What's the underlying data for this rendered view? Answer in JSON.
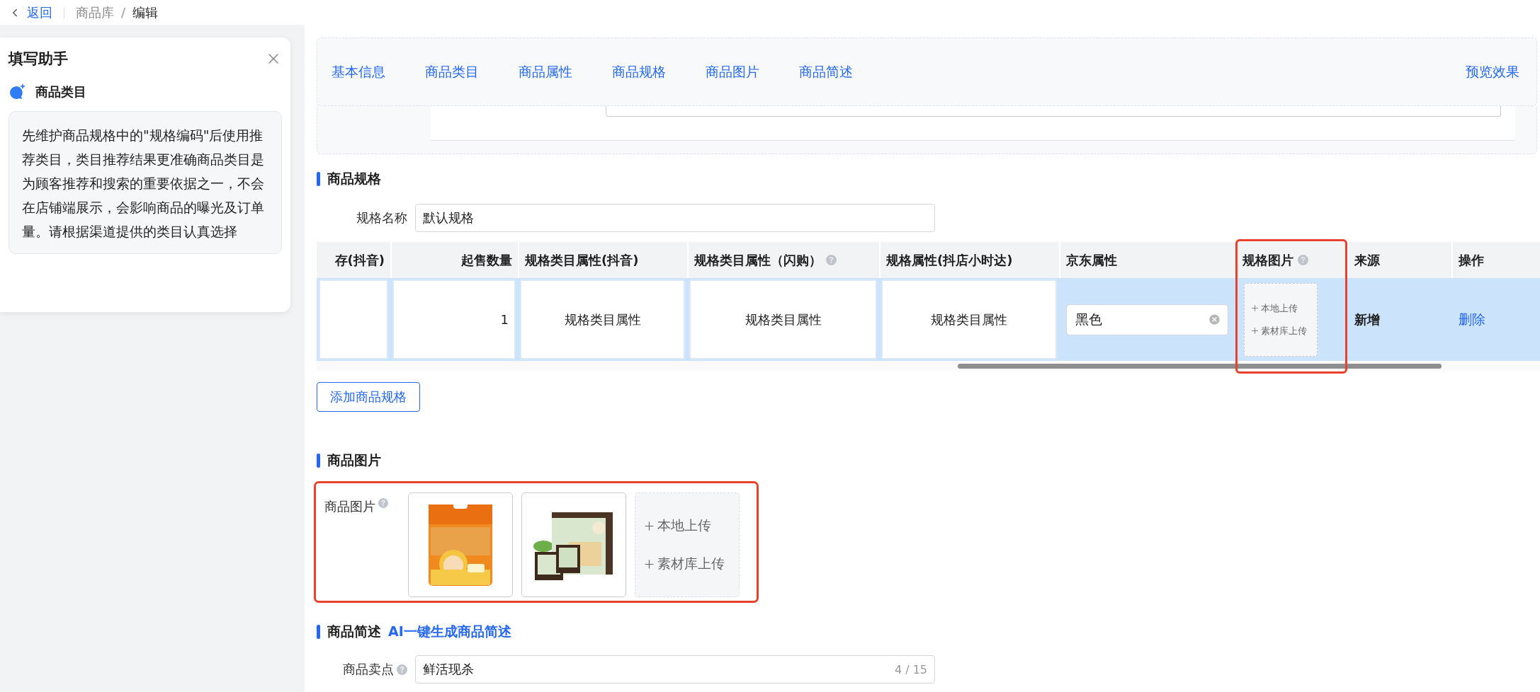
{
  "breadcrumb": {
    "back": "返回",
    "path": [
      "商品库",
      "编辑"
    ],
    "separator": "/"
  },
  "assistant": {
    "title": "填写助手",
    "topic": "商品类目",
    "text": "先维护商品规格中的\"规格编码\"后使用推荐类目，类目推荐结果更准确商品类目是为顾客推荐和搜索的重要依据之一，不会在店铺端展示，会影响商品的曝光及订单量。请根据渠道提供的类目认真选择"
  },
  "nav": {
    "tabs": [
      "基本信息",
      "商品类目",
      "商品属性",
      "商品规格",
      "商品图片",
      "商品简述"
    ],
    "preview": "预览效果"
  },
  "spec_section": {
    "title": "商品规格",
    "name_label": "规格名称",
    "name_value": "默认规格",
    "table": {
      "columns": [
        {
          "label": "存(抖音)",
          "help": false,
          "highlighted": false
        },
        {
          "label": "起售数量",
          "help": false,
          "highlighted": false
        },
        {
          "label": "规格类目属性(抖音)",
          "help": false,
          "highlighted": false
        },
        {
          "label": "规格类目属性（闪购）",
          "help": true,
          "highlighted": false
        },
        {
          "label": "规格属性(抖店小时达)",
          "help": false,
          "highlighted": false
        },
        {
          "label": "京东属性",
          "help": false,
          "highlighted": false
        },
        {
          "label": "规格图片",
          "help": true,
          "highlighted": true
        },
        {
          "label": "来源",
          "help": false,
          "highlighted": false
        },
        {
          "label": "操作",
          "help": false,
          "highlighted": false
        }
      ],
      "rows": [
        {
          "selected": true,
          "cells": [
            {
              "kind": "box"
            },
            {
              "kind": "number",
              "text": "1"
            },
            {
              "kind": "box",
              "text": "规格类目属性"
            },
            {
              "kind": "box",
              "text": "规格类目属性"
            },
            {
              "kind": "box",
              "text": "规格类目属性"
            },
            {
              "kind": "tag_input",
              "text": "黑色"
            },
            {
              "kind": "upload",
              "options": [
                "本地上传",
                "素材库上传"
              ]
            },
            {
              "kind": "text",
              "text": "新增"
            },
            {
              "kind": "link",
              "text": "删除"
            }
          ]
        }
      ]
    },
    "add_button": "添加商品规格"
  },
  "image_section": {
    "title": "商品图片",
    "label": "商品图片",
    "help": true,
    "highlighted": true,
    "upload": [
      "本地上传",
      "素材库上传"
    ]
  },
  "summary_section": {
    "title": "商品简述",
    "ai_link": "AI一键生成商品简述",
    "field_label": "商品卖点",
    "help": true,
    "field_value": "鲜活现杀",
    "counter": "4 / 15"
  }
}
